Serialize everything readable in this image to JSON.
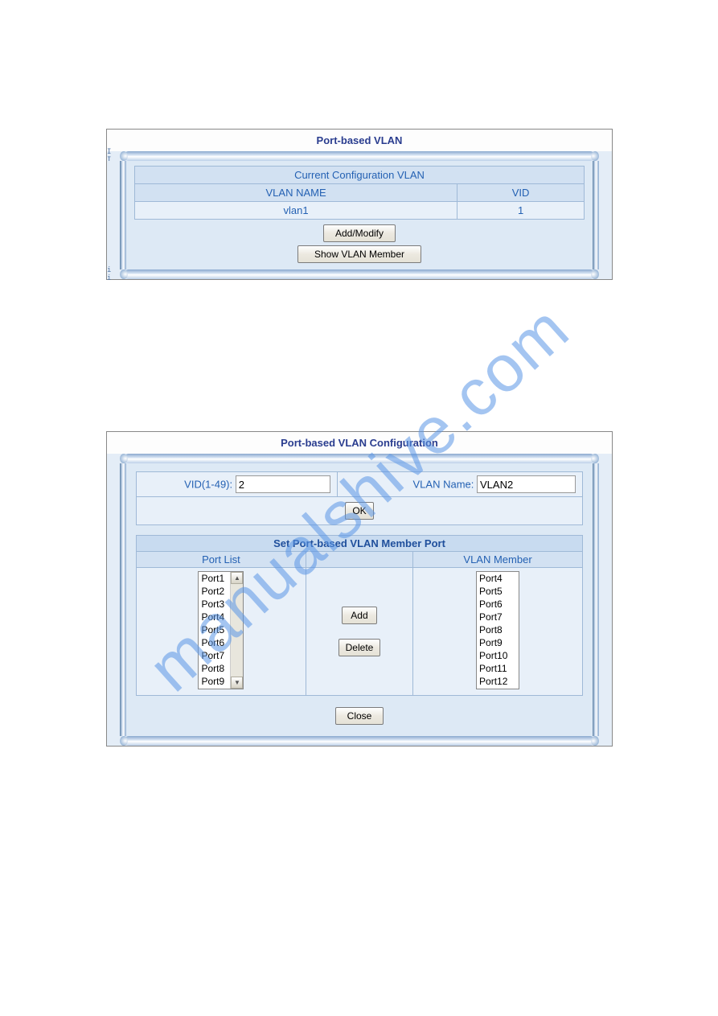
{
  "watermark": "manualshive.com",
  "panel1": {
    "title": "Port-based  VLAN",
    "section_title": "Current Configuration VLAN",
    "col1_header": "VLAN NAME",
    "col2_header": "VID",
    "row1_name": "vlan1",
    "row1_vid": "1",
    "btn_add_modify": "Add/Modify",
    "btn_show_member": "Show VLAN Member",
    "marker_top": "I I",
    "marker_bottom": "i i"
  },
  "panel2": {
    "title": "Port-based  VLAN Configuration",
    "vid_label": "VID(1-49):",
    "vid_value": "2",
    "vlan_name_label": "VLAN Name:",
    "vlan_name_value": "VLAN2",
    "btn_ok": "OK",
    "section_title": "Set Port-based VLAN Member Port",
    "col_port_list": "Port List",
    "col_vlan_member": "VLAN Member",
    "btn_add": "Add",
    "btn_delete": "Delete",
    "btn_close": "Close",
    "port_list": [
      "Port1",
      "Port2",
      "Port3",
      "Port4",
      "Port5",
      "Port6",
      "Port7",
      "Port8",
      "Port9"
    ],
    "vlan_member": [
      "Port4",
      "Port5",
      "Port6",
      "Port7",
      "Port8",
      "Port9",
      "Port10",
      "Port11",
      "Port12"
    ]
  }
}
